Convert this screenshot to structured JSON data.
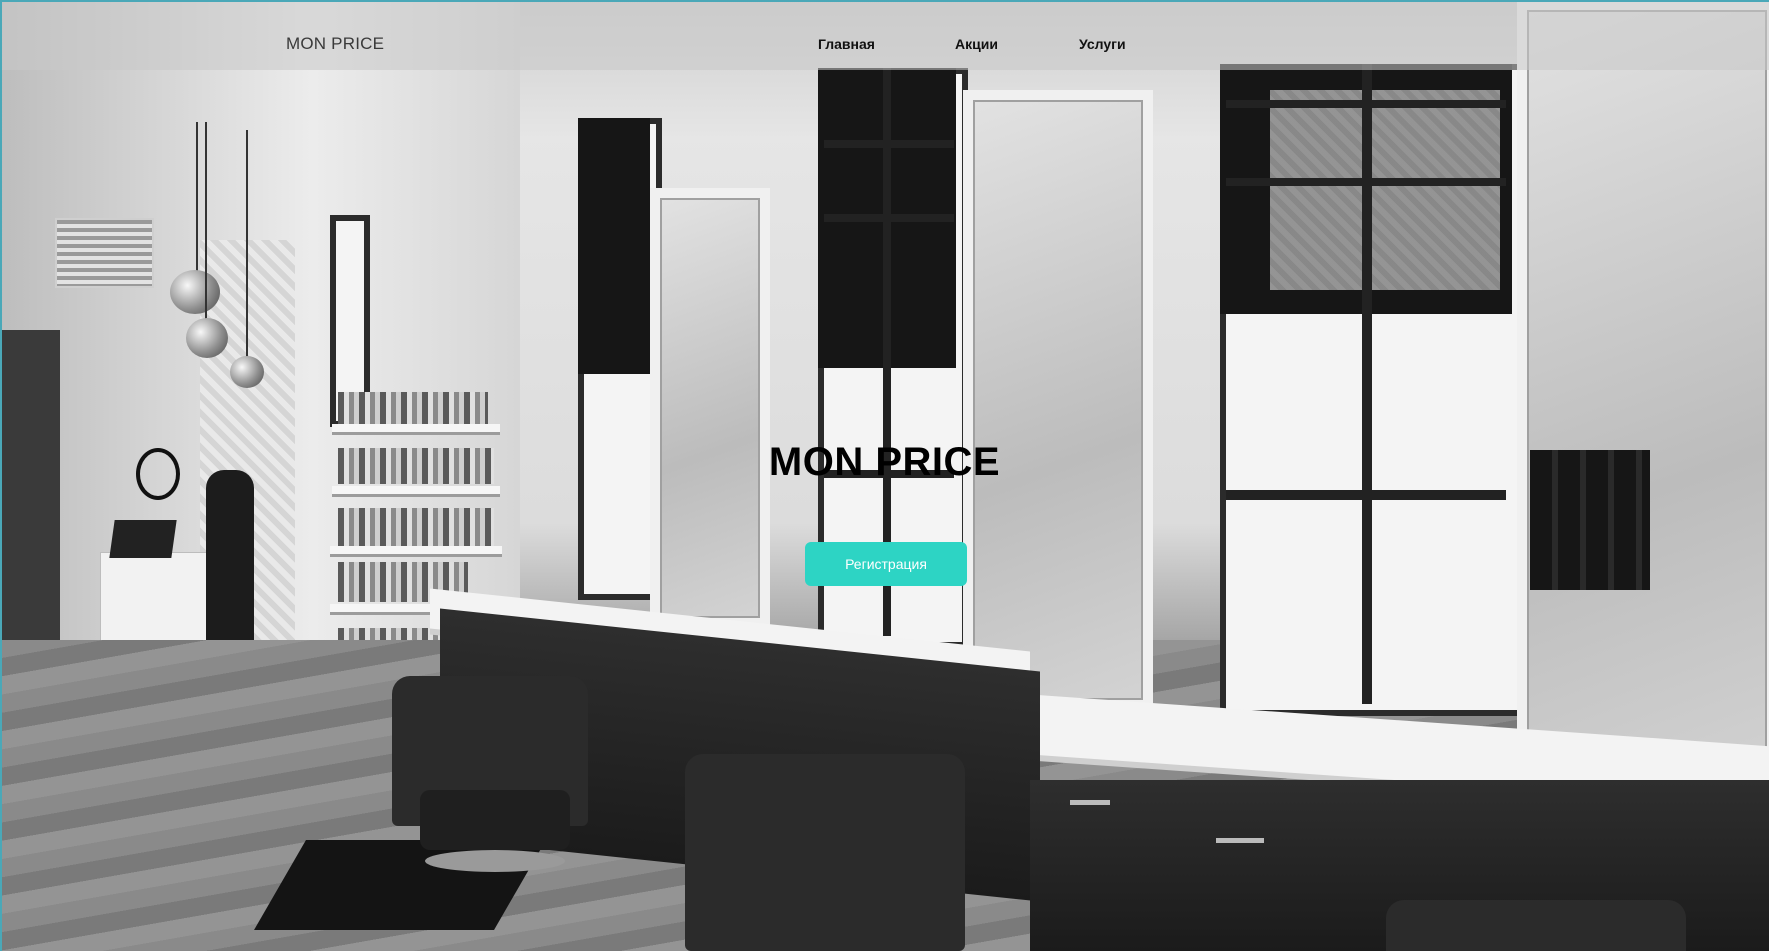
{
  "theme": {
    "accent": "#2dd4c4",
    "nav_text": "#111111",
    "title_text": "#000000"
  },
  "navbar": {
    "brand": "MON PRICE",
    "links": [
      {
        "label": "Главная"
      },
      {
        "label": "Акции"
      },
      {
        "label": "Услуги"
      }
    ]
  },
  "hero": {
    "title": "MON PRICE",
    "cta_label": "Регистрация"
  }
}
